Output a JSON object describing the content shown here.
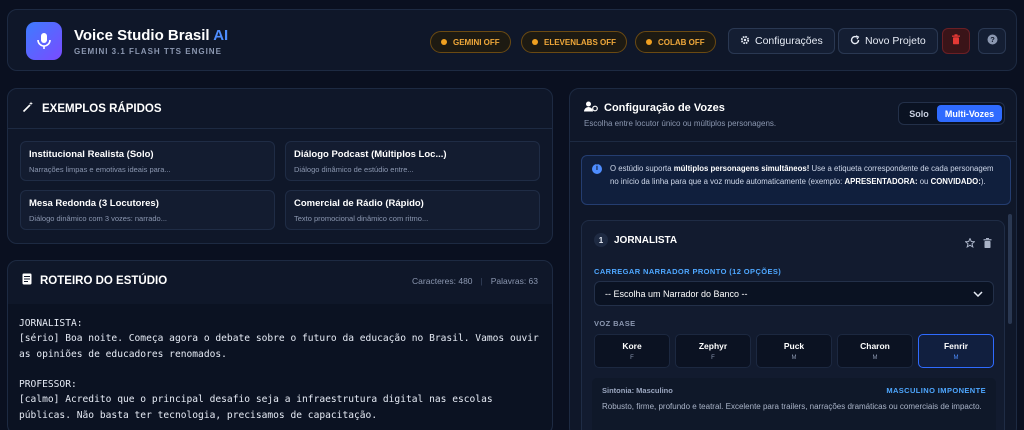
{
  "header": {
    "title": "Voice Studio Brasil",
    "title_badge": "AI",
    "subtitle": "GEMINI 3.1 FLASH TTS ENGINE",
    "status": [
      {
        "label": "GEMINI OFF"
      },
      {
        "label": "ELEVENLABS OFF"
      },
      {
        "label": "COLAB OFF"
      }
    ],
    "settings_label": "Configurações",
    "new_project_label": "Novo Projeto",
    "colors": {
      "accent": "#2f6bff",
      "warning": "#f0a020",
      "danger": "#e53935"
    }
  },
  "examples": {
    "title": "EXEMPLOS RÁPIDOS",
    "items": [
      {
        "title": "Institucional Realista (Solo)",
        "desc": "Narrações limpas e emotivas ideais para..."
      },
      {
        "title": "Diálogo Podcast (Múltiplos Loc...)",
        "desc": "Diálogo dinâmico de estúdio entre..."
      },
      {
        "title": "Mesa Redonda (3 Locutores)",
        "desc": "Diálogo dinâmico com 3 vozes: narrado..."
      },
      {
        "title": "Comercial de Rádio (Rápido)",
        "desc": "Texto promocional dinâmico com ritmo..."
      }
    ]
  },
  "script": {
    "title": "ROTEIRO DO ESTÚDIO",
    "chars_label": "Caracteres: 480",
    "words_label": "Palavras: 63",
    "text": "JORNALISTA:\n[sério] Boa noite. Começa agora o debate sobre o futuro da educação no Brasil. Vamos ouvir as opiniões de educadores renomados.\n\nPROFESSOR:\n[calmo] Acredito que o principal desafio seja a infraestrutura digital nas escolas públicas. Não basta ter tecnologia, precisamos de capacitação."
  },
  "voices": {
    "title": "Configuração de Vozes",
    "subtitle": "Escolha entre locutor único ou múltiplos personagens.",
    "mode_solo": "Solo",
    "mode_multi": "Multi-Vozes",
    "info": {
      "p1": "O estúdio suporta ",
      "b1": "múltiplos personagens simultâneos!",
      "p2": " Use a etiqueta correspondente de cada personagem no início da linha para que a voz mude automaticamente (exemplo: ",
      "b2": "APRESENTADORA:",
      "p3": " ou ",
      "b3": "CONVIDADO:",
      "p4": ")."
    },
    "speaker": {
      "number": "1",
      "name": "JORNALISTA",
      "preset_label": "CARREGAR NARRADOR PRONTO (12 OPÇÕES)",
      "preset_placeholder": "-- Escolha um Narrador do Banco --",
      "base_label": "VOZ BASE",
      "options": [
        {
          "name": "Kore",
          "gender": "F"
        },
        {
          "name": "Zephyr",
          "gender": "F"
        },
        {
          "name": "Puck",
          "gender": "M"
        },
        {
          "name": "Charon",
          "gender": "M"
        },
        {
          "name": "Fenrir",
          "gender": "M"
        }
      ],
      "selected": "Fenrir",
      "tuning_label": "Sintonia: Masculino",
      "profile": "MASCULINO IMPONENTE",
      "description": "Robusto, firme, profundo e teatral. Excelente para trailers, narrações dramáticas ou comerciais de impacto."
    }
  }
}
